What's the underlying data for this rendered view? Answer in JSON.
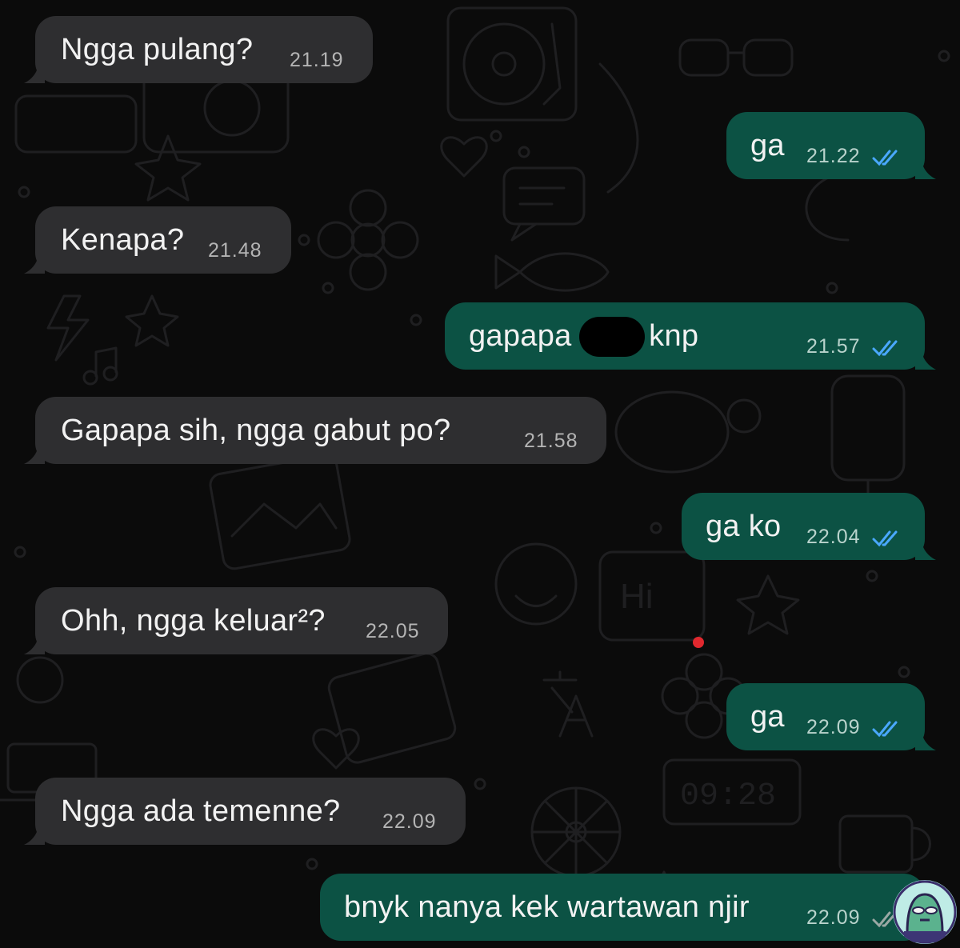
{
  "colors": {
    "background": "#0b0b0b",
    "incoming_bubble": "#2e2e30",
    "outgoing_bubble": "#0c5244",
    "read_ticks": "#4aa8ff"
  },
  "messages": [
    {
      "direction": "in",
      "text": "Ngga pulang?",
      "time": "21.19"
    },
    {
      "direction": "out",
      "text": "ga",
      "time": "21.22",
      "status": "read"
    },
    {
      "direction": "in",
      "text": "Kenapa?",
      "time": "21.48"
    },
    {
      "direction": "out",
      "text": "gapapa       emg knp",
      "time": "21.57",
      "status": "read",
      "partially_redacted": true
    },
    {
      "direction": "in",
      "text": "Gapapa sih, ngga gabut po?",
      "time": "21.58"
    },
    {
      "direction": "out",
      "text": "ga ko",
      "time": "22.04",
      "status": "read"
    },
    {
      "direction": "in",
      "text": "Ohh, ngga keluar²?",
      "time": "22.05"
    },
    {
      "direction": "out",
      "text": "ga",
      "time": "22.09",
      "status": "read"
    },
    {
      "direction": "in",
      "text": "Ngga ada temenne?",
      "time": "22.09"
    },
    {
      "direction": "out",
      "text": "bnyk nanya kek wartawan njir",
      "time": "22.09",
      "status": "delivered"
    }
  ],
  "wallpaper": {
    "icons": [
      "record-player-icon",
      "glasses-icon",
      "camera-icon",
      "star-icon",
      "heart-icon",
      "chat-icon",
      "flower-icon",
      "fish-icon",
      "lightning-icon",
      "music-note-icon",
      "turtle-icon",
      "ice-cream-icon",
      "picture-frame-icon",
      "hi-bubble-icon",
      "clover-icon",
      "translate-icon",
      "digital-clock-icon",
      "citrus-icon",
      "cup-icon",
      "phone-icon",
      "laptop-icon"
    ],
    "clock_text": "09:28",
    "hi_text": "Hi"
  }
}
